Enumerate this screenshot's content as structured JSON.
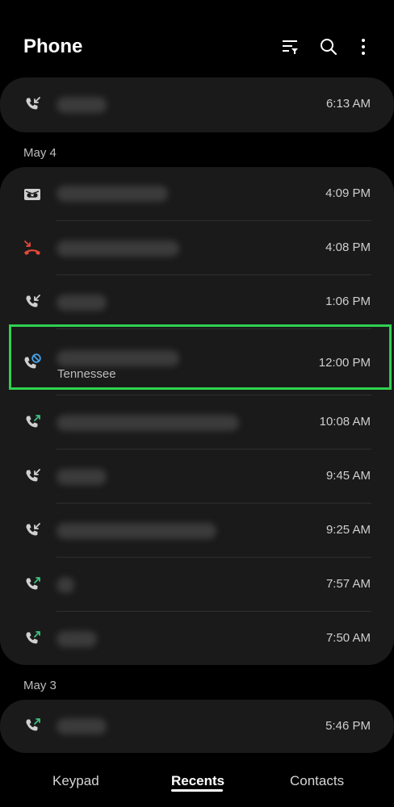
{
  "header": {
    "title": "Phone",
    "icons": [
      "filter-icon",
      "search-icon",
      "more-options-icon"
    ]
  },
  "calls": {
    "top": [
      {
        "type": "incoming",
        "time": "6:13 AM"
      }
    ],
    "groups": [
      {
        "date": "May 4",
        "items": [
          {
            "type": "voicemail",
            "time": "4:09 PM"
          },
          {
            "type": "missed",
            "time": "4:08 PM"
          },
          {
            "type": "incoming",
            "time": "1:06 PM"
          },
          {
            "type": "blocked",
            "subtitle": "Tennessee",
            "time": "12:00 PM"
          },
          {
            "type": "outgoing",
            "time": "10:08 AM"
          },
          {
            "type": "incoming",
            "time": "9:45 AM"
          },
          {
            "type": "incoming",
            "time": "9:25 AM"
          },
          {
            "type": "outgoing",
            "time": "7:57 AM"
          },
          {
            "type": "outgoing",
            "time": "7:50 AM"
          }
        ]
      },
      {
        "date": "May 3",
        "items": [
          {
            "type": "outgoing",
            "time": "5:46 PM"
          }
        ]
      }
    ]
  },
  "tabs": [
    {
      "label": "Keypad",
      "active": false
    },
    {
      "label": "Recents",
      "active": true
    },
    {
      "label": "Contacts",
      "active": false
    }
  ],
  "colors": {
    "background": "#000000",
    "card": "#1a1a1a",
    "missed": "#e5493a",
    "outgoing_arrow": "#3fbf7f",
    "blocked": "#4aa3e8",
    "highlight": "#2fd14f"
  }
}
